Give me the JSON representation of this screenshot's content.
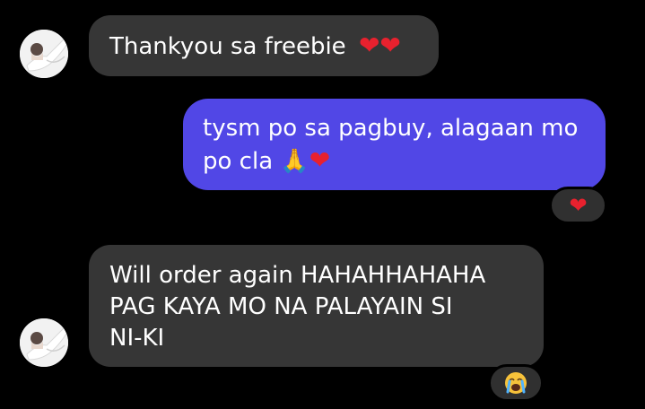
{
  "messages": [
    {
      "id": "m1",
      "direction": "incoming",
      "text": "Thankyou sa freebie",
      "emoji": "❤️❤️"
    },
    {
      "id": "m2",
      "direction": "outgoing",
      "line1": "tysm po sa pagbuy, alagaan mo",
      "line2": "po cla",
      "emoji": "🙏❤️",
      "reaction": "❤️"
    },
    {
      "id": "m3",
      "direction": "incoming",
      "lines": [
        "Will order again HAHAHHAHAHA",
        "PAG KAYA MO NA PALAYAIN SI",
        "NI-KI"
      ],
      "reaction": "😭"
    }
  ],
  "colors": {
    "background": "#000000",
    "incoming_bubble": "#363636",
    "outgoing_bubble": "#5147e6",
    "text": "#ffffff",
    "heart": "#e8212e"
  },
  "icons": {
    "avatar": "profile-photo",
    "heart": "red-heart-emoji",
    "pray": "folded-hands-emoji",
    "crying": "loudly-crying-face-emoji"
  }
}
